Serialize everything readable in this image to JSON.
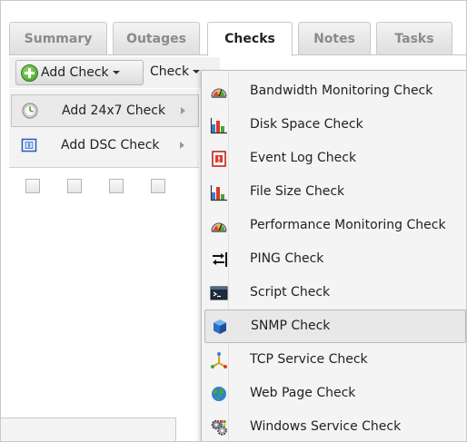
{
  "tabs": [
    {
      "label": "Summary",
      "active": false
    },
    {
      "label": "Outages",
      "active": false
    },
    {
      "label": "Checks",
      "active": true
    },
    {
      "label": "Notes",
      "active": false
    },
    {
      "label": "Tasks",
      "active": false
    }
  ],
  "toolbar": {
    "add_check_label": "Add Check",
    "check_label": "Check"
  },
  "submenu": [
    {
      "label": "Add 24x7 Check",
      "icon": "clock-icon",
      "highlighted": true
    },
    {
      "label": "Add DSC Check",
      "icon": "dsc-icon",
      "highlighted": false
    }
  ],
  "check_menu": [
    {
      "label": "Bandwidth Monitoring Check",
      "icon": "gauge-icon"
    },
    {
      "label": "Disk Space Check",
      "icon": "disk-chart-icon"
    },
    {
      "label": "Event Log Check",
      "icon": "event-log-icon"
    },
    {
      "label": "File Size Check",
      "icon": "file-size-icon"
    },
    {
      "label": "Performance Monitoring Check",
      "icon": "gauge-icon"
    },
    {
      "label": "PING Check",
      "icon": "ping-icon"
    },
    {
      "label": "Script Check",
      "icon": "terminal-icon"
    },
    {
      "label": "SNMP Check",
      "icon": "cube-icon",
      "highlighted": true
    },
    {
      "label": "TCP Service Check",
      "icon": "tcp-icon"
    },
    {
      "label": "Web Page Check",
      "icon": "globe-icon"
    },
    {
      "label": "Windows Service Check",
      "icon": "gears-icon"
    }
  ],
  "colors": {
    "accent_green": "#3e9c20",
    "menu_bg": "#f4f4f4",
    "highlight_bg": "#e8e8e8"
  }
}
